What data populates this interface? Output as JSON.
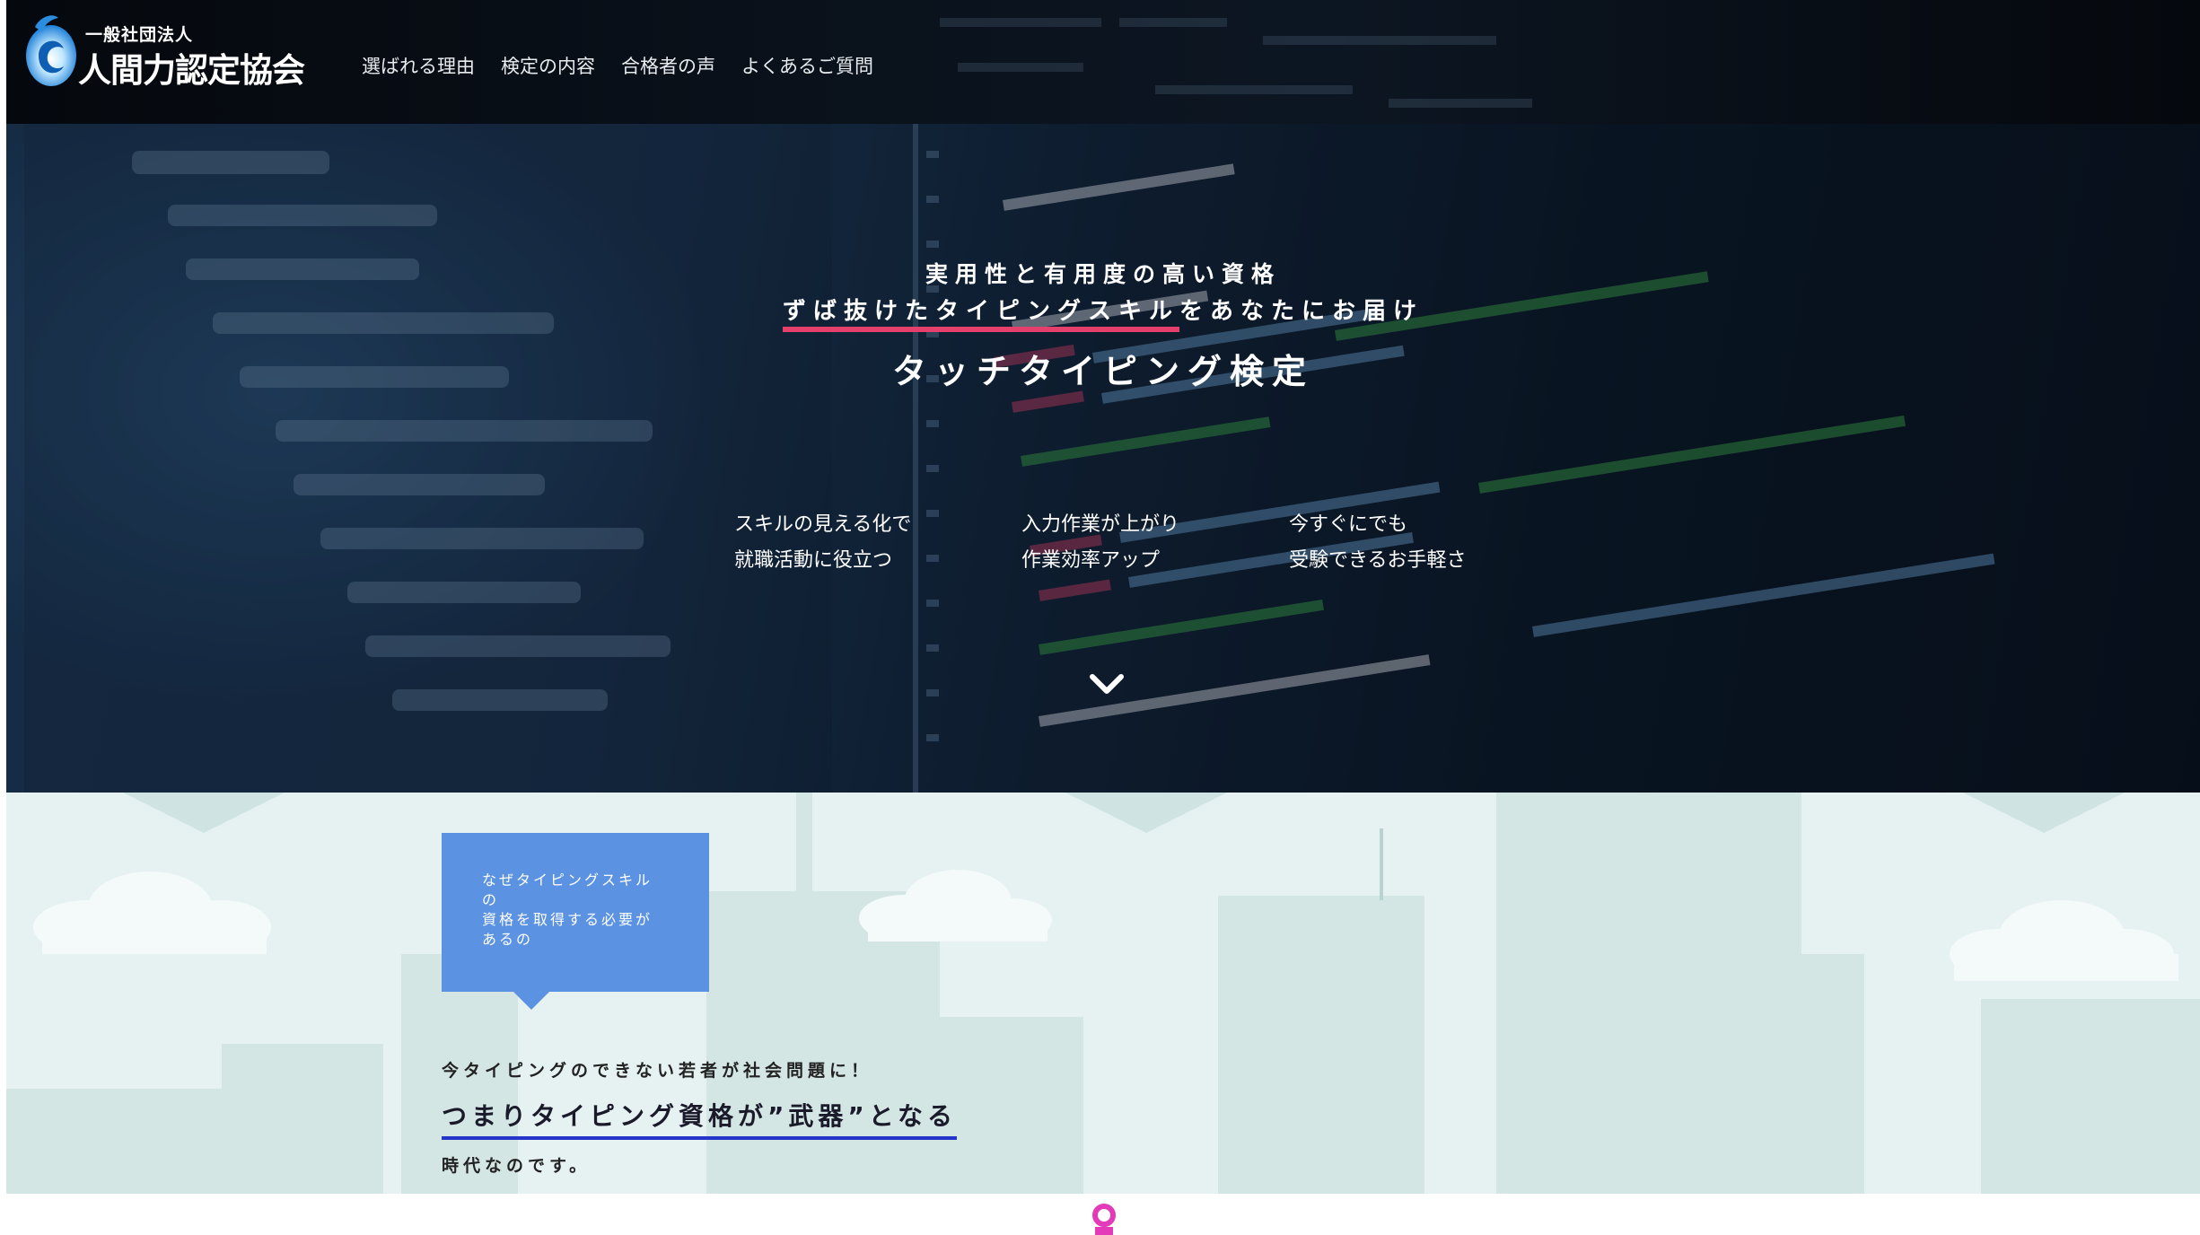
{
  "header": {
    "logo": {
      "small_text": "一般社団法人",
      "big_text": "人間力認定協会"
    },
    "nav": [
      {
        "label": "選ばれる理由"
      },
      {
        "label": "検定の内容"
      },
      {
        "label": "合格者の声"
      },
      {
        "label": "よくあるご質問"
      }
    ]
  },
  "hero": {
    "line1": "実用性と有用度の高い資格",
    "line2_highlight": "ずば抜けたタイピングスキル",
    "line2_rest": "をあなたにお届け",
    "title": "タッチタイピング検定",
    "features": [
      {
        "line1": "スキルの見える化で",
        "line2": "就職活動に役立つ"
      },
      {
        "line1": "入力作業が上がり",
        "line2": "作業効率アップ"
      },
      {
        "line1": "今すぐにでも",
        "line2": "受験できるお手軽さ"
      }
    ],
    "scroll_icon": "chevron-down-icon"
  },
  "intro": {
    "bubble_lines": [
      "なぜタイピングスキル",
      "の",
      "資格を取得する必要が",
      "あるの"
    ],
    "lead": "今タイピングのできない若者が社会問題に！",
    "key": "つまりタイピング資格が”武器”となる",
    "tail": "時代なのです。"
  },
  "colors": {
    "header_bg": "#05080d",
    "highlight_underline": "#e4406b",
    "bubble_bg": "#5b93e2",
    "key_underline": "#2535c9",
    "city_bg": "#e6f1f1",
    "pink_icon": "#e23ab8"
  }
}
